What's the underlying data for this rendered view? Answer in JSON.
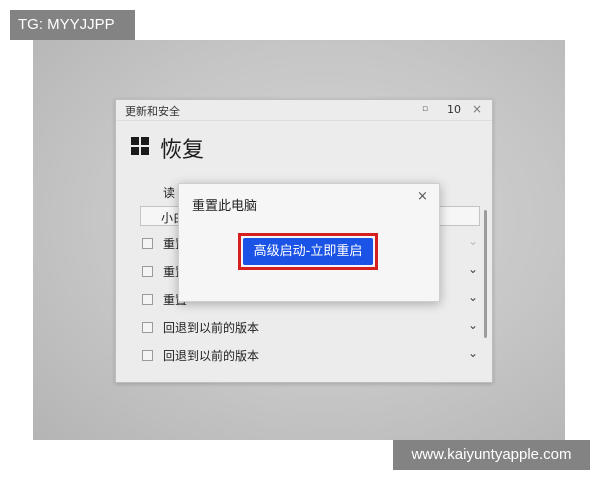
{
  "watermarks": {
    "top_left": "TG: MYYJJPP",
    "bottom_right": "www.kaiyuntyapple.com"
  },
  "settings_window": {
    "app_title": "更新和安全",
    "window_controls": {
      "minimize_icon": "square-small-icon",
      "number": "10",
      "close": "×"
    },
    "page_heading": "恢复",
    "logo_icon": "windows-logo-icon",
    "truncated_label": "读",
    "truncated_input_value": "小白",
    "rows": [
      {
        "label": "重置",
        "checkbox": "unchecked",
        "chevron": "⌄"
      },
      {
        "label": "重置",
        "checkbox": "unchecked",
        "chevron": "⌄"
      },
      {
        "label": "重置",
        "checkbox": "unchecked",
        "chevron": "⌄"
      },
      {
        "label": "回退到以前的版本",
        "checkbox": "unchecked",
        "chevron": "⌄"
      },
      {
        "label": "回退到以前的版本",
        "checkbox": "unchecked",
        "chevron": "⌄"
      }
    ]
  },
  "dialog": {
    "title": "重置此电脑",
    "close": "×",
    "primary_button": "高级启动-立即重启",
    "highlight_color": "#d62020",
    "button_color": "#1b53e6"
  }
}
